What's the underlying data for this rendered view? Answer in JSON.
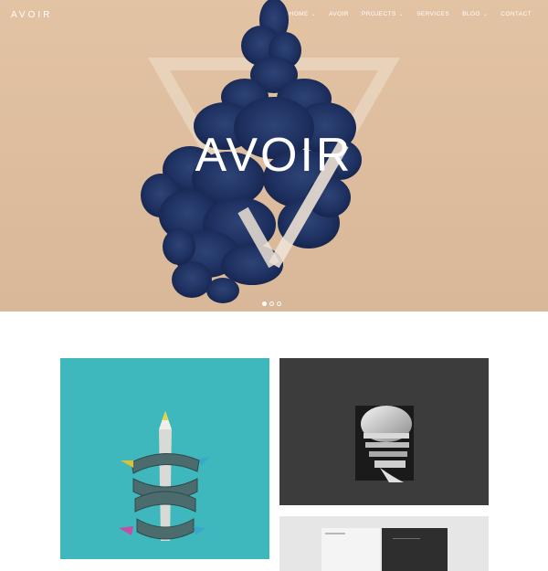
{
  "header": {
    "logo": "AVOIR",
    "nav": [
      {
        "label": "HOME",
        "dropdown": true
      },
      {
        "label": "AVOIR",
        "dropdown": false
      },
      {
        "label": "PROJECTS",
        "dropdown": true
      },
      {
        "label": "SERVICES",
        "dropdown": false
      },
      {
        "label": "BLOG",
        "dropdown": true
      },
      {
        "label": "CONTACT",
        "dropdown": false
      }
    ],
    "dropdown_icon": "chevron-down-icon"
  },
  "hero": {
    "title": "AVOIR",
    "slides_total": 3,
    "active_slide": 1,
    "background_color": "#ddbd9d",
    "ink_color": "#1e2f5c"
  },
  "portfolio": {
    "items": [
      {
        "image": "pencil-sculpture",
        "background": "#3fb8bd"
      },
      {
        "image": "hand-portrait",
        "background": "#3c3c3c"
      },
      {
        "image": "print-layout",
        "background": "#e6e6e6"
      }
    ]
  }
}
